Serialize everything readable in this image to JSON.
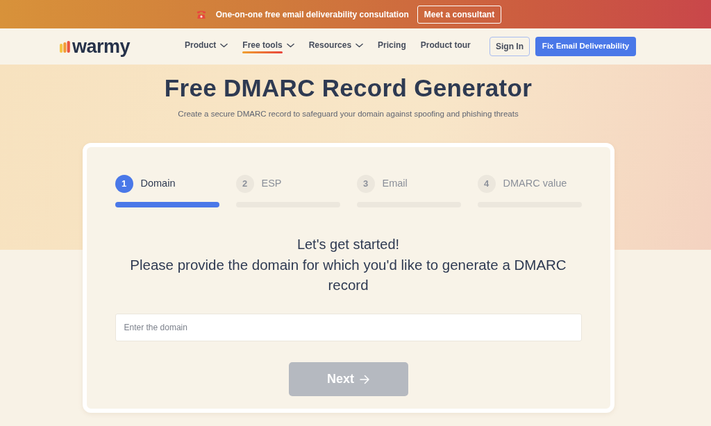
{
  "promo_banner": {
    "text": "One-on-one free email deliverability consultation",
    "button": "Meet a consultant"
  },
  "header": {
    "logo": "warmy",
    "nav": [
      {
        "label": "Product",
        "dropdown": true,
        "selected": false
      },
      {
        "label": "Free tools",
        "dropdown": true,
        "selected": true
      },
      {
        "label": "Resources",
        "dropdown": true,
        "selected": false
      },
      {
        "label": "Pricing",
        "dropdown": false,
        "selected": false
      },
      {
        "label": "Product tour",
        "dropdown": false,
        "selected": false
      }
    ],
    "sign_in": "Sign In",
    "cta": "Fix Email Deliverability"
  },
  "hero": {
    "title": "Free DMARC Record Generator",
    "subtitle": "Create a secure DMARC record to safeguard your domain against spoofing and phishing threats"
  },
  "wizard": {
    "steps": [
      {
        "number": "1",
        "label": "Domain",
        "selected": true
      },
      {
        "number": "2",
        "label": "ESP",
        "selected": false
      },
      {
        "number": "3",
        "label": "Email",
        "selected": false
      },
      {
        "number": "4",
        "label": "DMARC value",
        "selected": false
      }
    ],
    "greeting": "Let's get started!",
    "prompt": "Please provide the domain for which you'd like to generate a DMARC record",
    "domain_field": {
      "placeholder": "Enter the domain"
    },
    "next_button": {
      "label": "Next",
      "disabled": true
    }
  }
}
